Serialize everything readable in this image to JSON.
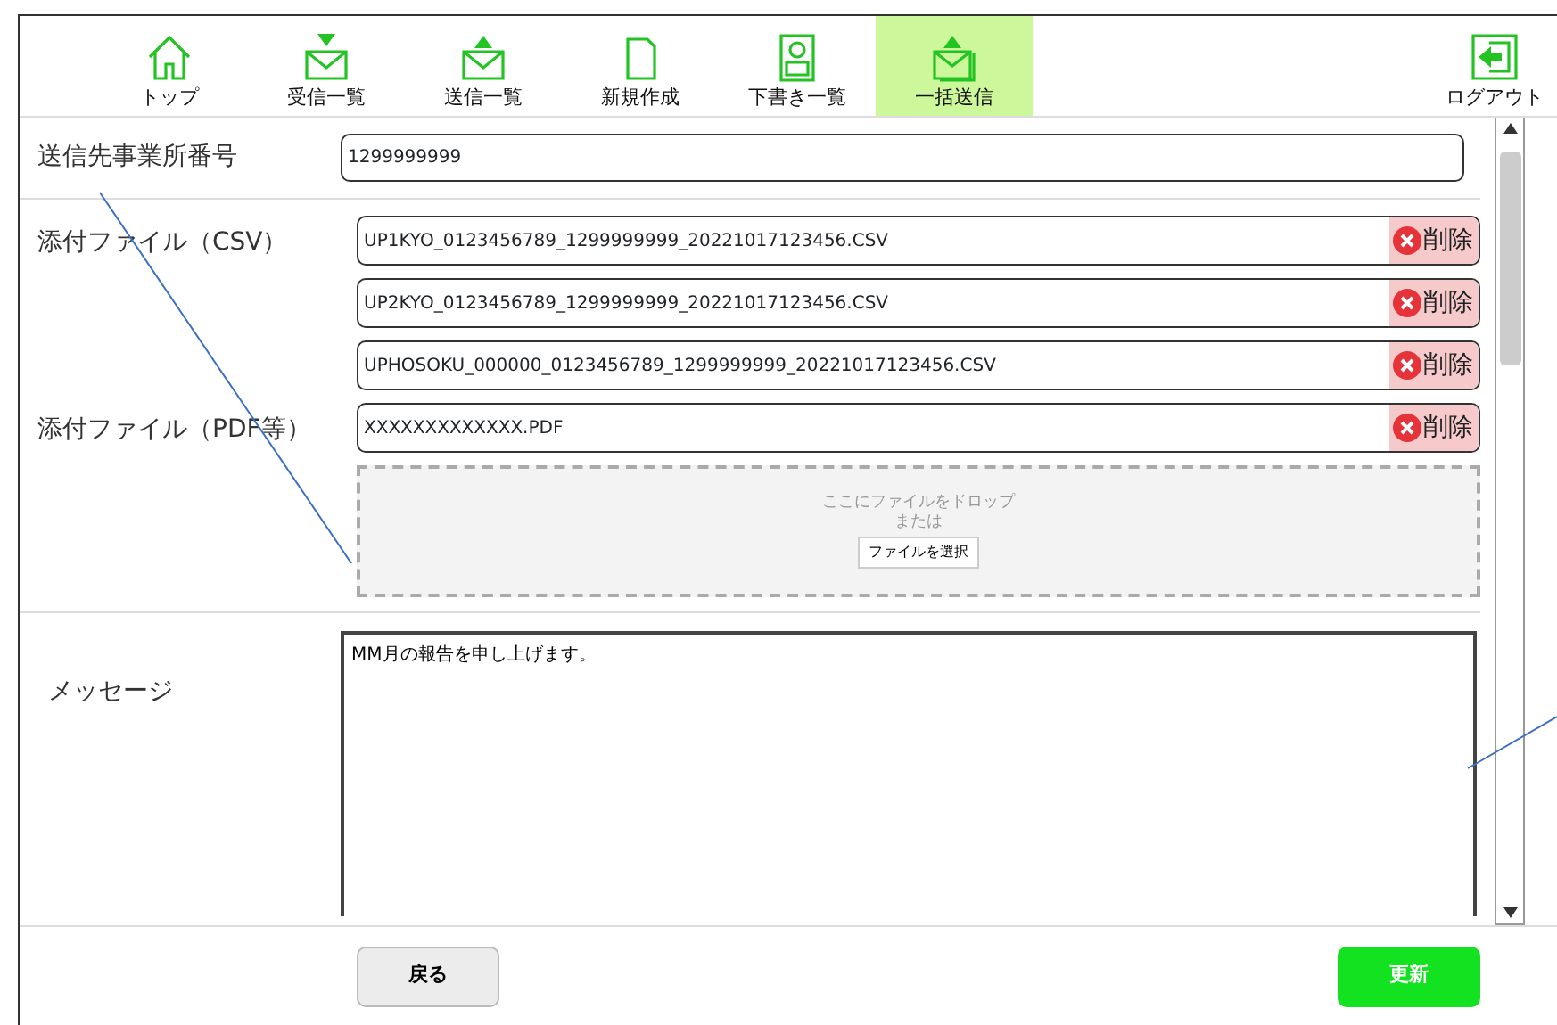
{
  "nav": [
    {
      "label": "トップ",
      "selected": false
    },
    {
      "label": "受信一覧",
      "selected": false
    },
    {
      "label": "送信一覧",
      "selected": false
    },
    {
      "label": "新規作成",
      "selected": false
    },
    {
      "label": "下書き一覧",
      "selected": false
    },
    {
      "label": "一括送信",
      "selected": true
    }
  ],
  "logout": {
    "label": "ログアウト"
  },
  "destination": {
    "label": "送信先事業所番号",
    "value": "1299999999"
  },
  "attachments": [
    {
      "label": "添付ファイル（CSV）",
      "files": [
        {
          "name": "UP1KYO_0123456789_1299999999_20221017123456.CSV",
          "delete_label": "削除"
        },
        {
          "name": "UP2KYO_0123456789_1299999999_20221017123456.CSV",
          "delete_label": "削除"
        },
        {
          "name": "UPHOSOKU_000000_0123456789_1299999999_20221017123456.CSV",
          "delete_label": "削除"
        }
      ]
    },
    {
      "label": "添付ファイル（PDF等）",
      "files": [
        {
          "name": "XXXXXXXXXXXXX.PDF",
          "delete_label": "削除"
        }
      ]
    }
  ],
  "dropzone": {
    "text": "ここにファイルをドロップ",
    "or_text": "または",
    "button": "ファイルを選択"
  },
  "message": {
    "label": "メッセージ",
    "value": "MM月の報告を申し上げます。"
  },
  "buttons": [
    {
      "kind": "back",
      "label": "戻る"
    },
    {
      "kind": "update",
      "label": "更新"
    }
  ]
}
